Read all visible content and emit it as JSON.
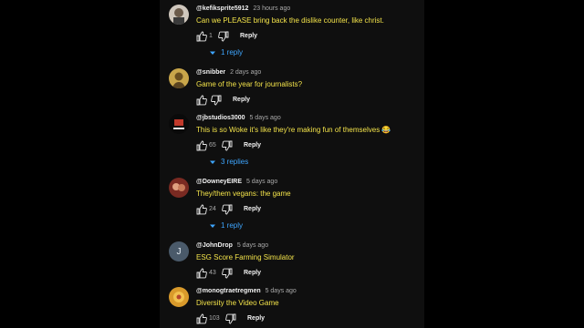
{
  "comments": [
    {
      "handle": "@kefiksprite5912",
      "time": "23 hours ago",
      "text": "Can we PLEASE bring back the dislike counter, like christ.",
      "likes": "1",
      "reply_label": "Reply",
      "replies_label": "1 reply"
    },
    {
      "handle": "@snibber",
      "time": "2 days ago",
      "text": "Game of the year for journalists?",
      "likes": "",
      "reply_label": "Reply"
    },
    {
      "handle": "@jbstudios3000",
      "time": "5 days ago",
      "text": "This is so Woke it's like they're making fun of themselves 😂",
      "likes": "65",
      "reply_label": "Reply",
      "replies_label": "3 replies"
    },
    {
      "handle": "@DowneyEIRE",
      "time": "5 days ago",
      "text": "They/them vegans: the game",
      "likes": "24",
      "reply_label": "Reply",
      "replies_label": "1 reply"
    },
    {
      "handle": "@JohnDrop",
      "time": "5 days ago",
      "text": "ESG Score Farming Simulator",
      "likes": "43",
      "reply_label": "Reply",
      "avatar_letter": "J"
    },
    {
      "handle": "@monogtraetregmen",
      "time": "5 days ago",
      "text": "Diversity the Video Game",
      "likes": "103",
      "reply_label": "Reply"
    }
  ],
  "icons": {
    "like": "thumb-up-icon",
    "dislike": "thumb-down-icon",
    "expand": "caret-down-icon"
  },
  "colors": {
    "comment_text": "#f3e34a",
    "link": "#3ea6ff",
    "background": "#0f0f0f"
  }
}
